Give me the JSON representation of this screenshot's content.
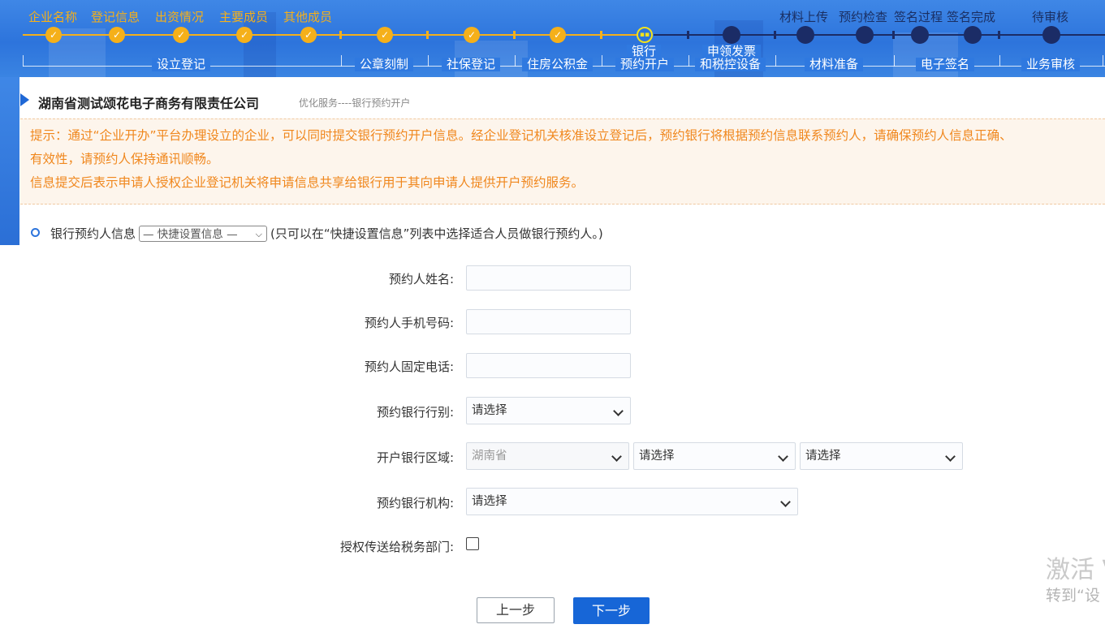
{
  "progress": {
    "done_steps": [
      "企业名称",
      "登记信息",
      "出资情况",
      "主要成员",
      "其他成员"
    ],
    "pending_steps": [
      "材料上传",
      "预约检查",
      "签名过程",
      "签名完成",
      "待审核"
    ],
    "groups": [
      {
        "label": "设立登记",
        "status": "done"
      },
      {
        "label": "公章刻制",
        "status": "done"
      },
      {
        "label": "社保登记",
        "status": "done"
      },
      {
        "label": "住房公积金",
        "status": "done"
      },
      {
        "label_line1": "银行",
        "label_line2": "预约开户",
        "status": "current"
      },
      {
        "label_line1": "申领发票",
        "label_line2": "和税控设备",
        "status": "todo"
      },
      {
        "label": "材料准备",
        "status": "todo"
      },
      {
        "label": "电子签名",
        "status": "todo"
      },
      {
        "label": "业务审核",
        "status": "todo"
      }
    ],
    "colors": {
      "done": "#f5b01a",
      "todo": "#1b2c66",
      "banner": "#2d74dc"
    }
  },
  "company": {
    "name": "湖南省测试颂花电子商务有限责任公司",
    "subtitle": "优化服务----银行预约开户"
  },
  "notice": {
    "line1": "提示：通过“企业开办”平台办理设立的企业，可以同时提交银行预约开户信息。经企业登记机关核准设立登记后，预约银行将根据预约信息联系预约人，请确保预约人信息正确、",
    "line2": "有效性，请预约人保持通讯顺畅。",
    "line3": "信息提交后表示申请人授权企业登记机关将申请信息共享给银行用于其向申请人提供开户预约服务。"
  },
  "contact": {
    "label": "银行预约人信息",
    "quick_select_value": "— 快捷设置信息 —",
    "hint": "(只可以在“快捷设置信息”列表中选择适合人员做银行预约人。)"
  },
  "form": {
    "name_label": "预约人姓名:",
    "name_value": "",
    "mobile_label": "预约人手机号码:",
    "mobile_value": "",
    "phone_label": "预约人固定电话:",
    "phone_value": "",
    "bank_type_label": "预约银行行别:",
    "bank_type_value": "请选择",
    "region_label": "开户银行区域:",
    "region_province": "湖南省",
    "region_city": "请选择",
    "region_district": "请选择",
    "branch_label": "预约银行机构:",
    "branch_value": "请选择",
    "tax_auth_label": "授权传送给税务部门:",
    "tax_auth_checked": false
  },
  "buttons": {
    "prev": "上一步",
    "next": "下一步"
  },
  "watermark": {
    "line1": "激活 V",
    "line2": "转到“设"
  }
}
